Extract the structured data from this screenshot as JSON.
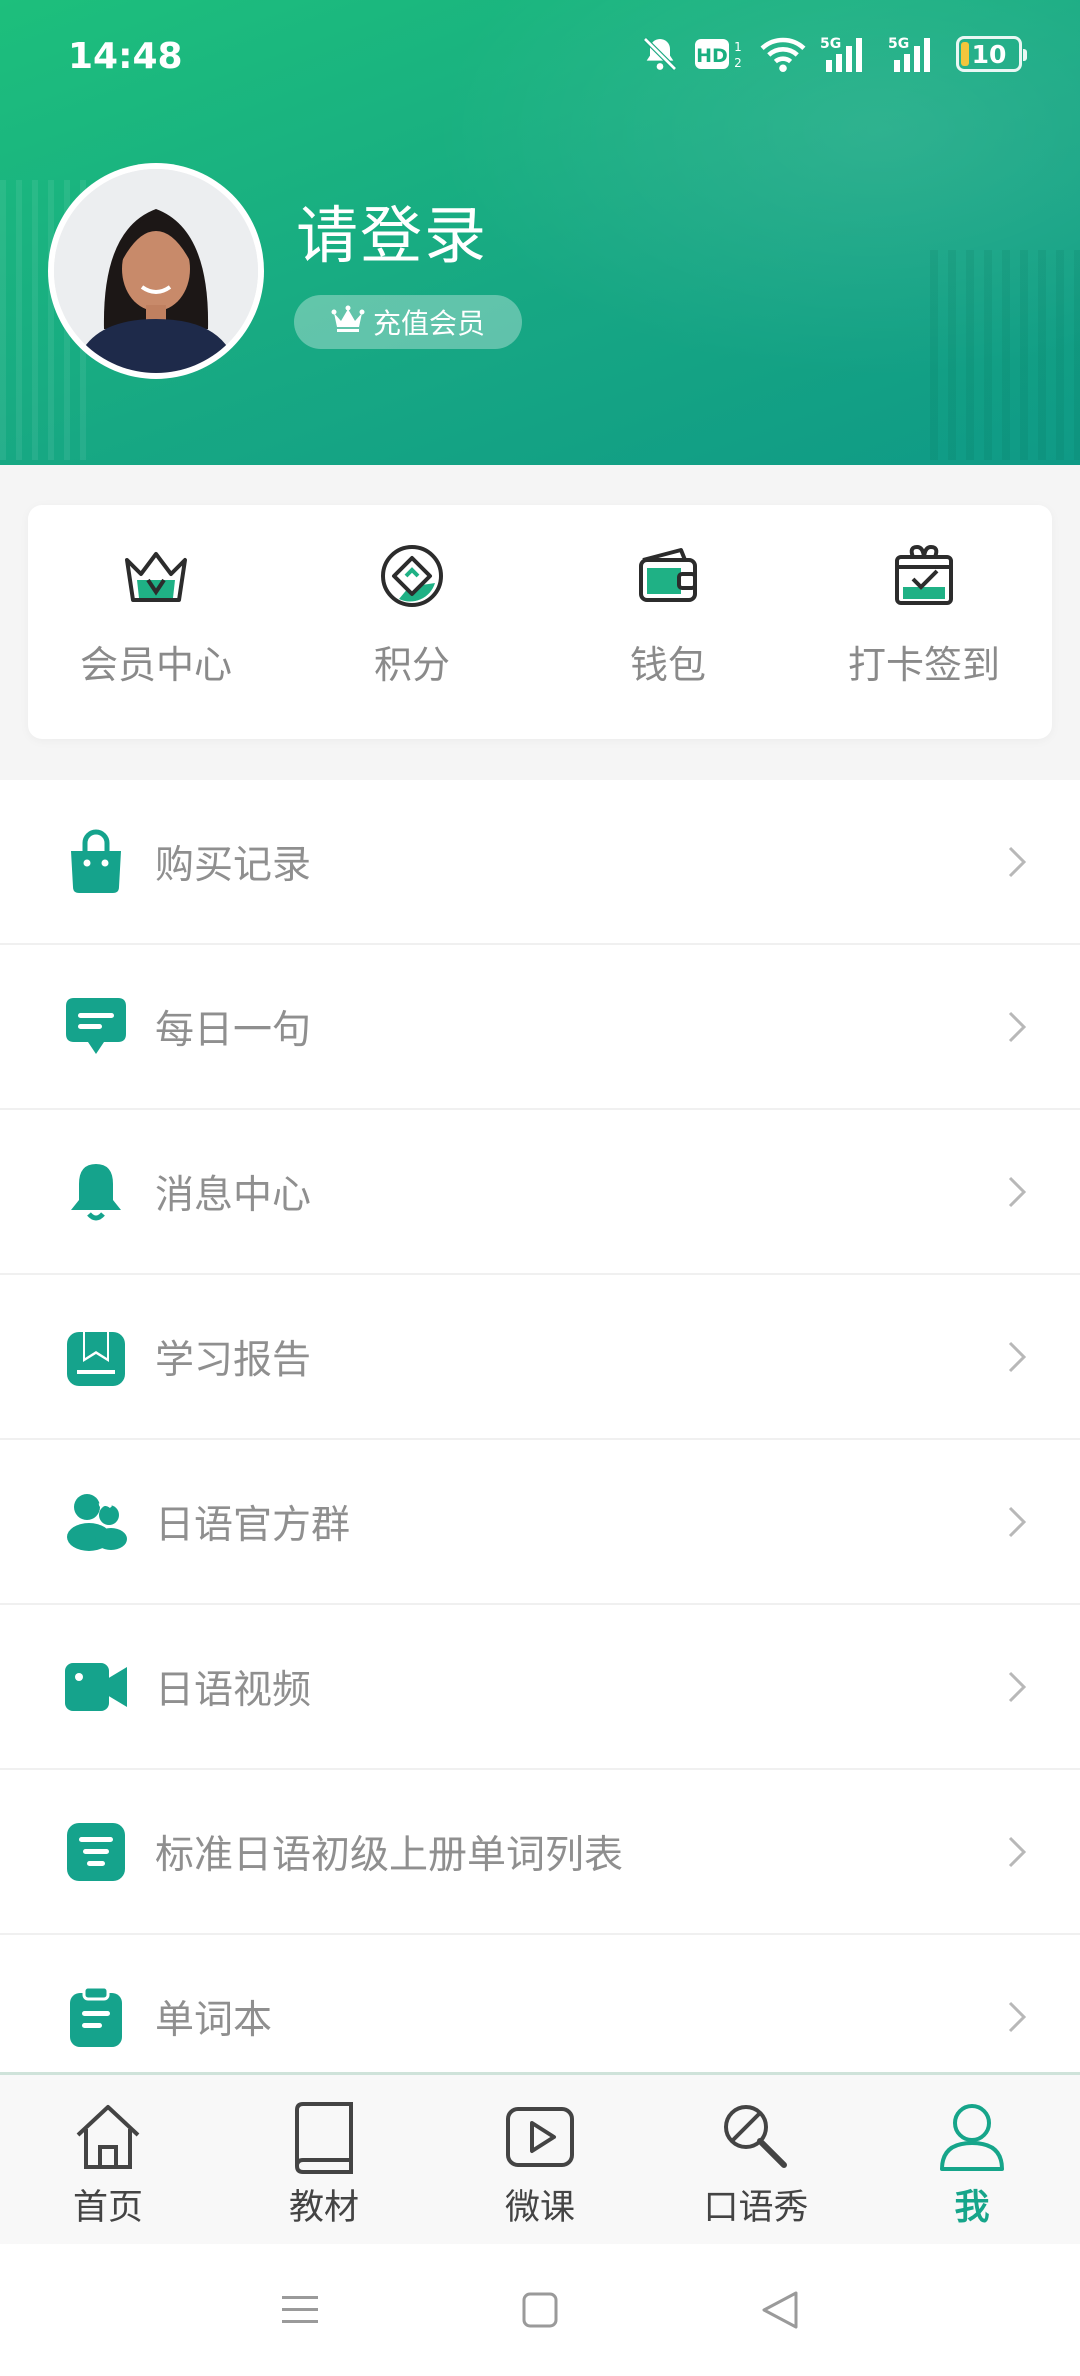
{
  "status_bar": {
    "time": "14:48",
    "battery": "10",
    "icons": [
      "mute-bell-icon",
      "hd-volte-icon",
      "wifi-icon",
      "5g-signal-icon",
      "5g-signal-icon",
      "battery-icon"
    ]
  },
  "profile": {
    "title": "请登录",
    "vip_badge": "充值会员",
    "avatar": "avatar-photo"
  },
  "quick_actions": [
    {
      "label": "会员中心",
      "icon": "crown-icon"
    },
    {
      "label": "积分",
      "icon": "points-diamond-icon"
    },
    {
      "label": "钱包",
      "icon": "wallet-icon"
    },
    {
      "label": "打卡签到",
      "icon": "checkin-gift-icon"
    }
  ],
  "menu": [
    {
      "label": "购买记录",
      "icon": "shopping-bag-icon"
    },
    {
      "label": "每日一句",
      "icon": "chat-bubble-icon"
    },
    {
      "label": "消息中心",
      "icon": "bell-icon"
    },
    {
      "label": "学习报告",
      "icon": "report-book-icon"
    },
    {
      "label": "日语官方群",
      "icon": "group-users-icon"
    },
    {
      "label": "日语视频",
      "icon": "video-camera-icon"
    },
    {
      "label": "标准日语初级上册单词列表",
      "icon": "list-doc-icon"
    },
    {
      "label": "单词本",
      "icon": "clipboard-icon"
    }
  ],
  "tabbar": [
    {
      "label": "首页",
      "icon": "home-icon",
      "active": false
    },
    {
      "label": "教材",
      "icon": "book-icon",
      "active": false
    },
    {
      "label": "微课",
      "icon": "play-icon",
      "active": false
    },
    {
      "label": "口语秀",
      "icon": "microphone-icon",
      "active": false
    },
    {
      "label": "我",
      "icon": "user-icon",
      "active": true
    }
  ],
  "colors": {
    "brand": "#16a58a",
    "header_start": "#1dbf7c",
    "header_end": "#0f9a86",
    "text_muted": "#8f8f8f"
  }
}
